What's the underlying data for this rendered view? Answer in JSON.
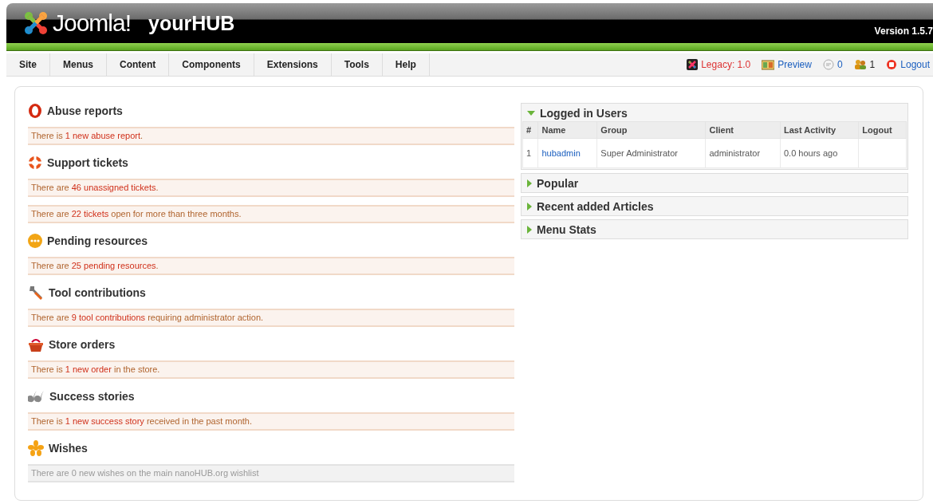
{
  "header": {
    "logo_text": "Joomla!",
    "site_name": "yourHUB",
    "version": "Version 1.5.7"
  },
  "menu": [
    {
      "label": "Site"
    },
    {
      "label": "Menus"
    },
    {
      "label": "Content"
    },
    {
      "label": "Components"
    },
    {
      "label": "Extensions"
    },
    {
      "label": "Tools"
    },
    {
      "label": "Help"
    }
  ],
  "status": [
    {
      "kind": "legacy",
      "label": "Legacy: 1.0"
    },
    {
      "kind": "preview",
      "label": "Preview"
    },
    {
      "kind": "messages",
      "label": "0"
    },
    {
      "kind": "users",
      "label": "1"
    },
    {
      "kind": "logout",
      "label": "Logout"
    }
  ],
  "sections": [
    {
      "kind": "abuse",
      "title": "Abuse reports",
      "messages": [
        {
          "before": "There is ",
          "link": "1 new abuse report",
          "after": ".",
          "muted": false
        }
      ]
    },
    {
      "kind": "support",
      "title": "Support tickets",
      "messages": [
        {
          "before": "There are ",
          "link": "46 unassigned tickets",
          "after": ".",
          "muted": false
        },
        {
          "before": "There are ",
          "link": "22 tickets",
          "after": " open for more than three months.",
          "muted": false
        }
      ]
    },
    {
      "kind": "pending",
      "title": "Pending resources",
      "messages": [
        {
          "before": "There are ",
          "link": "25 pending resources",
          "after": ".",
          "muted": false
        }
      ]
    },
    {
      "kind": "tool",
      "title": "Tool contributions",
      "messages": [
        {
          "before": "There are ",
          "link": "9 tool contributions",
          "after": " requiring administrator action.",
          "muted": false
        }
      ]
    },
    {
      "kind": "store",
      "title": "Store orders",
      "messages": [
        {
          "before": "There is ",
          "link": "1 new order",
          "after": " in the store.",
          "muted": false
        }
      ]
    },
    {
      "kind": "stories",
      "title": "Success stories",
      "messages": [
        {
          "before": "There is ",
          "link": "1 new success story",
          "after": " received in the past month.",
          "muted": false
        }
      ]
    },
    {
      "kind": "wishes",
      "title": "Wishes",
      "messages": [
        {
          "before": "There are 0 new wishes on the main nanoHUB.org wishlist",
          "muted": true
        }
      ]
    }
  ],
  "panels": [
    {
      "title": "Logged in Users",
      "expanded": true,
      "table": {
        "columns": [
          "#",
          "Name",
          "Group",
          "Client",
          "Last Activity",
          "Logout"
        ],
        "rows": [
          [
            "1",
            "hubadmin",
            "Super Administrator",
            "administrator",
            "0.0 hours ago",
            ""
          ]
        ]
      }
    },
    {
      "title": "Popular",
      "expanded": false
    },
    {
      "title": "Recent added Articles",
      "expanded": false
    },
    {
      "title": "Menu Stats",
      "expanded": false
    }
  ]
}
